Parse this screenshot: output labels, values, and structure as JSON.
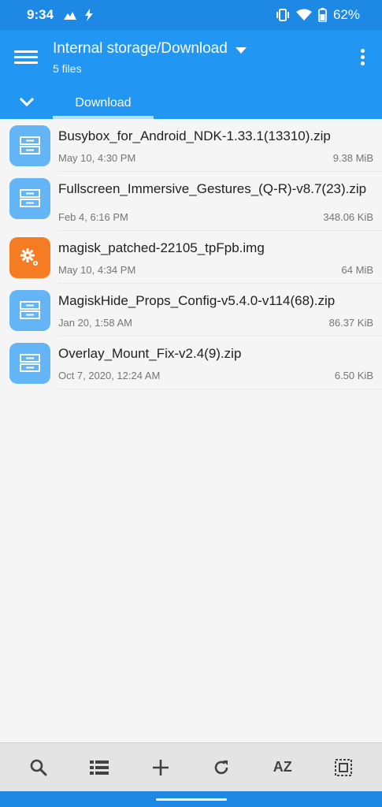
{
  "status_bar": {
    "time": "9:34",
    "battery": "62%",
    "icons": [
      "mountain-icon",
      "bolt-icon",
      "vibrate-icon",
      "wifi-icon",
      "battery-icon"
    ]
  },
  "app_bar": {
    "title": "Internal storage/Download",
    "subtitle": "5 files",
    "tab_label": "Download"
  },
  "files": [
    {
      "name": "Busybox_for_Android_NDK-1.33.1(13310).zip",
      "date": "May 10, 4:30 PM",
      "size": "9.38 MiB",
      "type": "zip"
    },
    {
      "name": "Fullscreen_Immersive_Gestures_(Q-R)-v8.7(23).zip",
      "date": "Feb 4, 6:16 PM",
      "size": "348.06 KiB",
      "type": "zip"
    },
    {
      "name": "magisk_patched-22105_tpFpb.img",
      "date": "May 10, 4:34 PM",
      "size": "64 MiB",
      "type": "img"
    },
    {
      "name": "MagiskHide_Props_Config-v5.4.0-v114(68).zip",
      "date": "Jan 20, 1:58 AM",
      "size": "86.37 KiB",
      "type": "zip"
    },
    {
      "name": "Overlay_Mount_Fix-v2.4(9).zip",
      "date": "Oct 7, 2020, 12:24 AM",
      "size": "6.50 KiB",
      "type": "zip"
    }
  ],
  "toolbar": {
    "sort_label": "AZ",
    "icons": [
      "search-icon",
      "list-view-icon",
      "add-icon",
      "refresh-icon",
      "sort-icon",
      "select-all-icon"
    ]
  },
  "colors": {
    "status_bar": "#1e88e5",
    "app_bar": "#2196f3",
    "zip_icon": "#64b5f6",
    "img_icon": "#f57c22",
    "tab_indicator": "#bbdefb"
  }
}
